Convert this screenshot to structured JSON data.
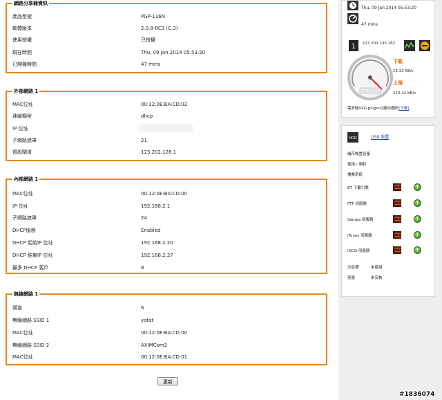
{
  "product": {
    "title": "網路分享器資訊",
    "rows": [
      {
        "label": "產品型號",
        "value": "PGP-116N"
      },
      {
        "label": "軟體版本",
        "value": "2.0.8-RC3 (C.3)"
      },
      {
        "label": "使用授權",
        "value": "已授權"
      },
      {
        "label": "現在時間",
        "value": "Thu, 09 Jan 2014 05:53:20"
      },
      {
        "label": "已開機時間",
        "value": "47 mins"
      }
    ]
  },
  "wan": {
    "title": "外部網路 1",
    "rows": [
      {
        "label": "MAC位址",
        "value": "00:12:0E:BA:CD:02"
      },
      {
        "label": "連線類型",
        "value": "dhcp"
      },
      {
        "label": "IP 位址",
        "value": ""
      },
      {
        "label": "子網路遮罩",
        "value": "21"
      },
      {
        "label": "預設閘道",
        "value": "123.202.128.1"
      }
    ]
  },
  "lan": {
    "title": "內部網路 1",
    "rows": [
      {
        "label": "MAC位址",
        "value": "00:12:0E:BA:CD:00"
      },
      {
        "label": "IP 位址",
        "value": "192.168.2.1"
      },
      {
        "label": "子網路遮罩",
        "value": "24"
      },
      {
        "label": "DHCP服務",
        "value": "Enabled"
      },
      {
        "label": "DHCP 起始IP 位址",
        "value": "192.168.2.20"
      },
      {
        "label": "DHCP 結束IP 位址",
        "value": "192.168.2.27"
      },
      {
        "label": "最多 DHCP 客戶",
        "value": "8"
      }
    ]
  },
  "wireless": {
    "title": "無線網路 1",
    "rows": [
      {
        "label": "頻道",
        "value": "6"
      },
      {
        "label": "無線網路 SSID 1",
        "value": "yatat"
      },
      {
        "label": "MAC位址",
        "value": "00:12:0E:BA:CD:00"
      },
      {
        "label": "無線網路 SSID 2",
        "value": "AXIMCom2"
      },
      {
        "label": "MAC位址",
        "value": "00:12:0E:BA:CD:01"
      }
    ]
  },
  "refresh_label": "更新",
  "sidebar": {
    "time": "Thu, 09 Jan 2014 05:53:20",
    "uptime": "47 mins",
    "ip": "123.202.135.162",
    "download_label": "下載",
    "download_rate": "16.32 KB/s",
    "upload_label": "上傳",
    "upload_rate": "213.42 KB/s",
    "svg_note": "需安裝SVG plugin以顯示圖形",
    "svg_link": "[下載]",
    "usb_icon_text": "HDD",
    "usb_link": "USB 設置",
    "usb_items": [
      "儲存裝置容量",
      "使用 / 剩餘",
      "檔案系統"
    ],
    "services": [
      "BT 下載引擎",
      "FTP 伺服器",
      "Samba 伺服器",
      "iTunes 伺服器",
      "iSCSI 伺服器"
    ],
    "status": [
      {
        "label": "分頁槽",
        "value": "未使用"
      },
      {
        "label": "容量",
        "value": "未安裝"
      }
    ]
  },
  "watermark": "#1836074"
}
